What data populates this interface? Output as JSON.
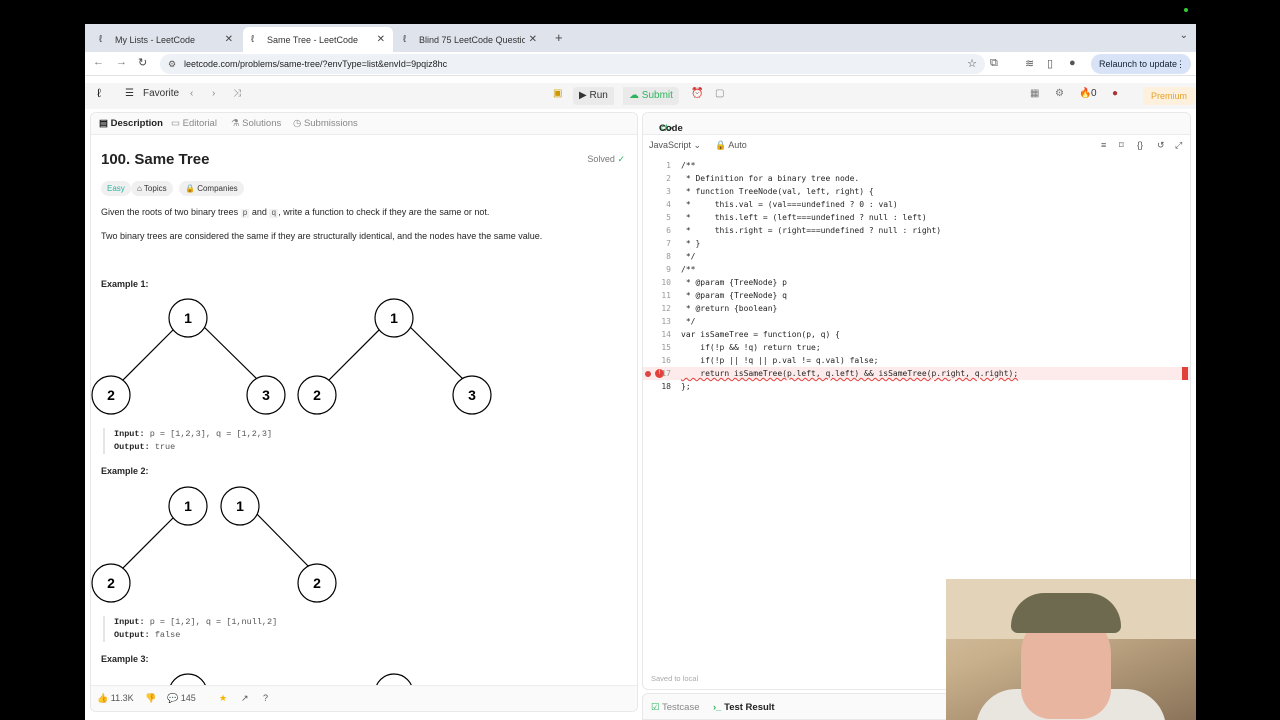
{
  "tabs": [
    {
      "title": "My Lists - LeetCode",
      "active": false
    },
    {
      "title": "Same Tree - LeetCode",
      "active": true
    },
    {
      "title": "Blind 75 LeetCode Questions",
      "active": false
    }
  ],
  "address": {
    "url": "leetcode.com/problems/same-tree/?envType=list&envId=9pqiz8hc",
    "relaunch_label": "Relaunch to update"
  },
  "lcheader": {
    "favorite": "Favorite",
    "run": "Run",
    "submit": "Submit",
    "streak": "0",
    "premium": "Premium"
  },
  "left_tabs": [
    {
      "label": "Description"
    },
    {
      "label": "Editorial"
    },
    {
      "label": "Solutions"
    },
    {
      "label": "Submissions"
    }
  ],
  "problem": {
    "title": "100. Same Tree",
    "status": "Solved",
    "chips": [
      "Easy",
      "Topics",
      "Companies"
    ],
    "para1_a": "Given the roots of two binary trees ",
    "para1_p": "p",
    "para1_b": " and ",
    "para1_q": "q",
    "para1_c": ", write a function to check if they are the same or not.",
    "para2": "Two binary trees are considered the same if they are structurally identical, and the nodes have the same value.",
    "examples": [
      {
        "heading": "Example 1:",
        "input_label": "Input:",
        "input": " p = [1,2,3], q = [1,2,3]",
        "output_label": "Output:",
        "output": " true"
      },
      {
        "heading": "Example 2:",
        "input_label": "Input:",
        "input": " p = [1,2], q = [1,null,2]",
        "output_label": "Output:",
        "output": " false"
      },
      {
        "heading": "Example 3:"
      }
    ],
    "tree1_nodes": [
      "1",
      "2",
      "3",
      "1",
      "2",
      "3"
    ],
    "tree2_nodes": [
      "1",
      "2",
      "1",
      "2"
    ]
  },
  "left_footer": {
    "likes": "11.3K",
    "comments": "145"
  },
  "code_panel": {
    "tab": "Code",
    "language": "JavaScript",
    "mode": "Auto",
    "saved": "Saved to local",
    "lines": [
      "/**",
      " * Definition for a binary tree node.",
      " * function TreeNode(val, left, right) {",
      " *     this.val = (val===undefined ? 0 : val)",
      " *     this.left = (left===undefined ? null : left)",
      " *     this.right = (right===undefined ? null : right)",
      " * }",
      " */",
      "/**",
      " * @param {TreeNode} p",
      " * @param {TreeNode} q",
      " * @return {boolean}",
      " */",
      "var isSameTree = function(p, q) {",
      "    if(!p && !q) return true;",
      "    if(!p || !q || p.val != q.val) false;",
      "    return isSameTree(p.left, q.left) && isSameTree(p.right, q.right);",
      "};"
    ]
  },
  "bottom_tabs": [
    {
      "label": "Testcase"
    },
    {
      "label": "Test Result"
    }
  ]
}
